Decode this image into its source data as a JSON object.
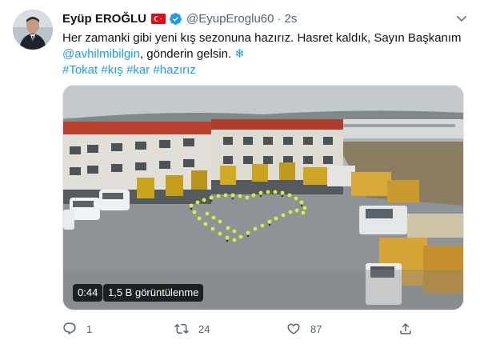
{
  "author": {
    "name": "Eyüp EROĞLU",
    "handle": "@EyupEroglu60",
    "separator": "·",
    "time": "2s"
  },
  "tweet": {
    "text_before_mention": "Her zamanki gibi yeni kış sezonuna hazırız. Hasret kaldık, Sayın Başkanım ",
    "mention": "@avhilmibilgin",
    "text_after_mention": ", gönderin gelsin. ",
    "emoji": "❄",
    "hashtags": [
      "#Tokat",
      "#kış",
      "#kar",
      "#hazırız"
    ]
  },
  "media": {
    "duration": "0:44",
    "views": "1,5 B görüntülenme"
  },
  "actions": {
    "reply_count": "1",
    "retweet_count": "24",
    "like_count": "87"
  },
  "icons": {
    "flag": "turkey-flag-icon",
    "verified": "verified-badge-icon",
    "more": "chevron-down-icon",
    "reply": "reply-icon",
    "retweet": "retweet-icon",
    "like": "heart-icon",
    "share": "share-icon"
  },
  "colors": {
    "accent": "#1d9bf0",
    "text": "#0f1419",
    "secondary": "#536471",
    "flag_red": "#e30a17"
  }
}
